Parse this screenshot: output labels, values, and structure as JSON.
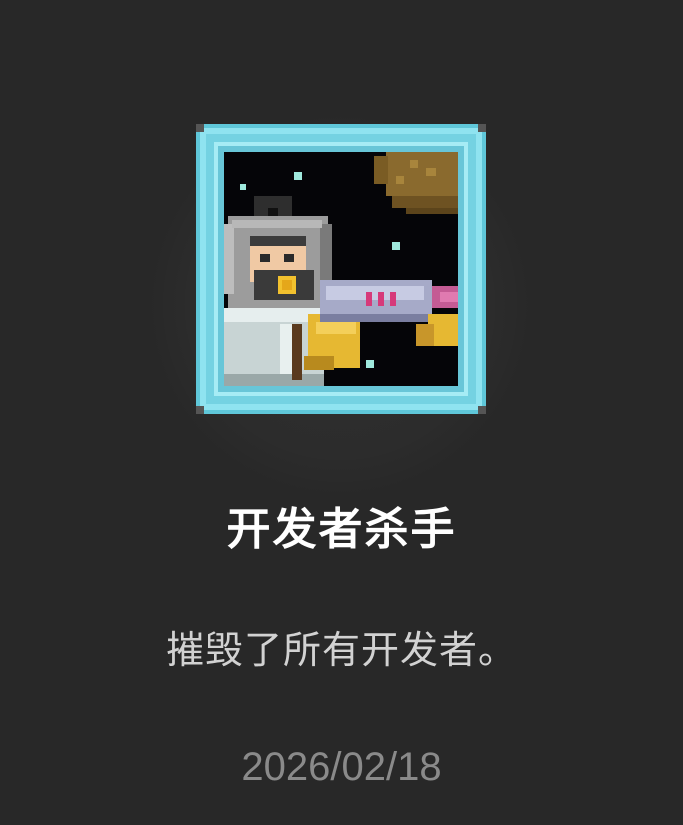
{
  "achievement": {
    "icon": "astronaut-with-raygun-pixel-art",
    "frame_color": "#7fd9e8",
    "title": "开发者杀手",
    "description": "摧毁了所有开发者。",
    "date": "2026/02/18"
  },
  "colors": {
    "background": "#282828",
    "title": "#ffffff",
    "description": "#d2d2d2",
    "date": "#8a8a8a"
  }
}
